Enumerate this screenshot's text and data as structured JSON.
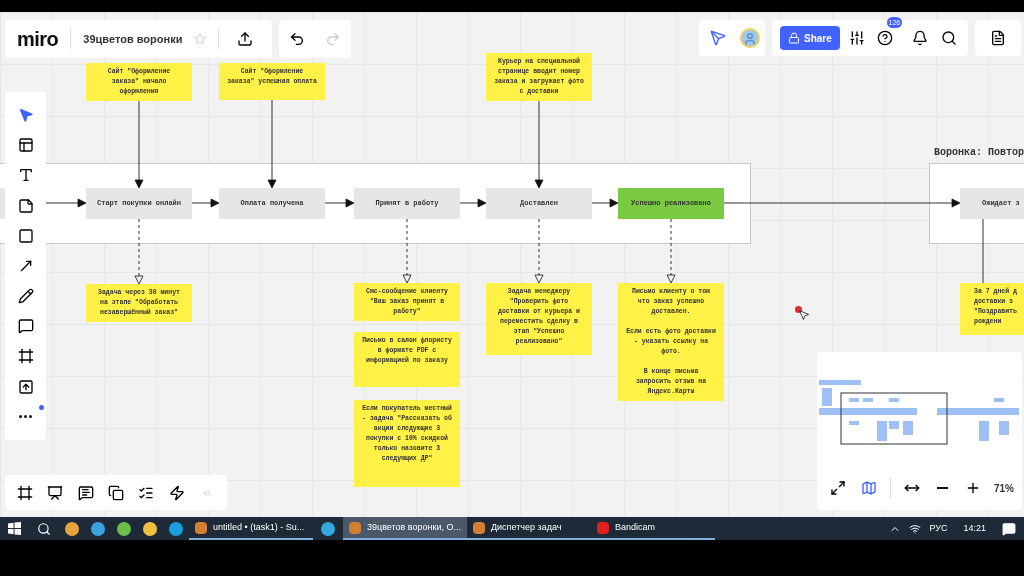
{
  "board": {
    "logo": "miro",
    "title": "39цветов воронки",
    "starred": false
  },
  "top_right": {
    "share": "Share",
    "help_count": "126"
  },
  "repeat_frame": {
    "title": "Воронка: Повтор"
  },
  "nodes": [
    {
      "kind": "step"
    },
    {
      "label": "Старт покупки онлайн",
      "kind": "step"
    },
    {
      "label": "Оплата получена",
      "kind": "step"
    },
    {
      "label": "Принят в работу",
      "kind": "step"
    },
    {
      "label": "Доставлен",
      "kind": "step"
    },
    {
      "label": "Успешно реализовано",
      "kind": "success"
    },
    {
      "label": "Ожидает з",
      "kind": "step"
    }
  ],
  "stickies": [
    {
      "text": "Сайт \"Оформление заказа\" начало оформления"
    },
    {
      "text": "Сайт \"Оформление заказа\" успешная оплата"
    },
    {
      "text": "Курьер на специальной странице вводит номер заказа и загружает фото с доставки"
    },
    {
      "text": "Задача через 30 минут на этапе \"Обработать незавершённый заказ\""
    },
    {
      "text": "Смс-сообщение клиенту \"Ваш заказ принят в работу\""
    },
    {
      "text": "Письмо в салон флористу в формате PDF с информацией по заказу"
    },
    {
      "text": "Если покупатель местный - задача \"Рассказать об акции следующие 3 покупки с 10% скидкой только назовите 3 следующих ДР\""
    },
    {
      "text": "Задача менеджеру \"Проверить фото доставки от курьера и переместить сделку в этап \"Успешно реализовано\""
    },
    {
      "text": "Письмо клиенту о том что заказ успешно доставлен.\n\nЕсли есть фото доставки - указать ссылку на фото.\n\nВ конце письма запросить отзыв на Яндекс.Карты"
    },
    {
      "text": "За 7 дней д\nдоставки з\n\"Поздравить\nрождени"
    }
  ],
  "minimap": {
    "zoom": "71%"
  },
  "taskbar": {
    "items": [
      {
        "label": "untitled • (task1) - Su...",
        "selected": false
      },
      {
        "label": "39цветов воронки, О...",
        "selected": true
      },
      {
        "label": "Диспетчер задач",
        "selected": false
      },
      {
        "label": "Bandicam",
        "selected": false
      }
    ],
    "language": "РУС",
    "time": "14:21"
  }
}
